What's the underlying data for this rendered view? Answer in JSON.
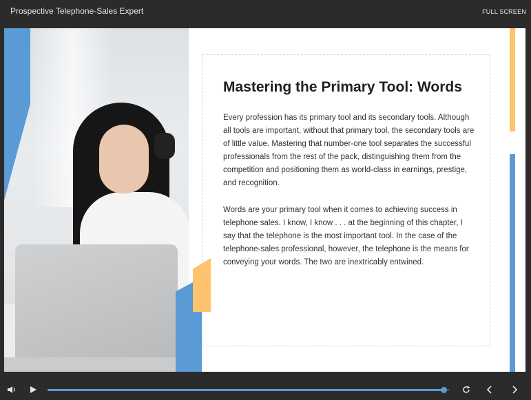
{
  "header": {
    "title": "Prospective Telephone-Sales Expert",
    "fullscreen_label": "FULL SCREEN"
  },
  "slide": {
    "heading": "Mastering the Primary Tool: Words",
    "paragraphs": [
      "Every profession has its primary tool and its secondary tools. Although all tools are important, without that primary tool, the secondary tools are of little value. Mastering that number-one tool separates the successful professionals from the rest of the pack, distinguishing them from the competition and positioning them as world-class in earnings, prestige, and recognition.",
      "Words are your primary tool when it comes to achieving success in telephone sales. I know, I know . . . at the beginning of this chapter, I say that the telephone is the most important tool. In the case of the telephone-sales professional, however, the telephone is the means for conveying your words. The two are inextricably entwined."
    ],
    "image": "woman-with-headset-at-laptop"
  },
  "player": {
    "progress_fraction": 0.985,
    "icons": {
      "volume": "volume-icon",
      "play": "play-icon",
      "replay": "replay-icon",
      "prev": "chevron-left-icon",
      "next": "chevron-right-icon"
    }
  },
  "colors": {
    "accent_blue": "#5b9bd5",
    "accent_orange": "#ffc36b",
    "chrome": "#2b2b2b"
  }
}
